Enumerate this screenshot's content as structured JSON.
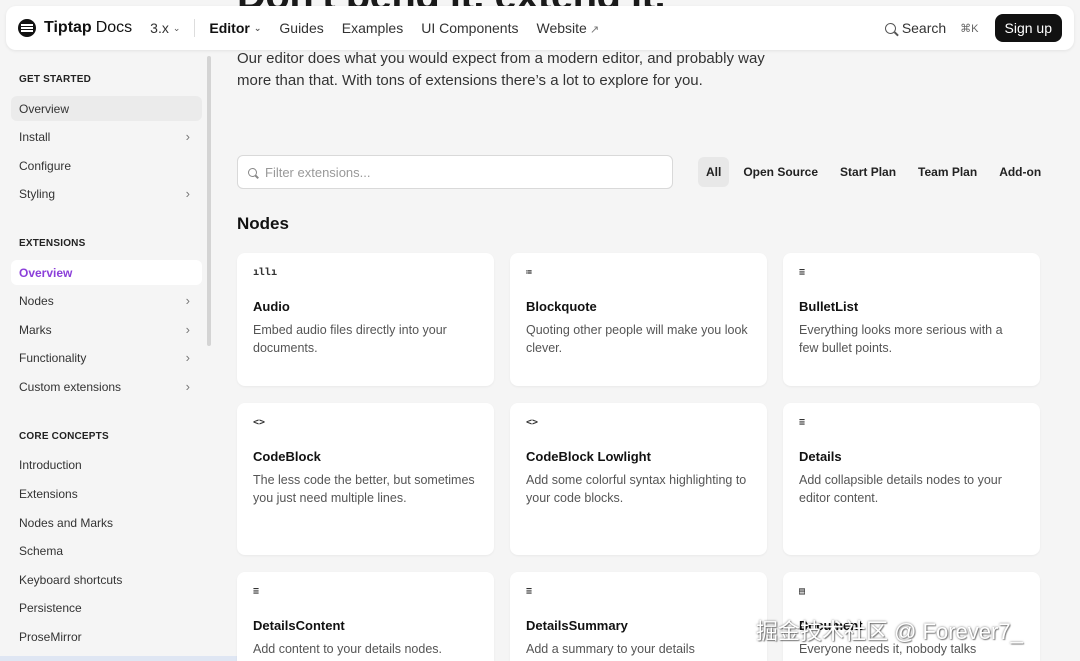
{
  "hero": {
    "title": "Don't bend it, extend it."
  },
  "header": {
    "logo_name": "Tiptap",
    "logo_sub": "Docs",
    "version": "3.x",
    "nav": [
      {
        "label": "Editor"
      },
      {
        "label": "Guides"
      },
      {
        "label": "Examples"
      },
      {
        "label": "UI Components"
      },
      {
        "label": "Website"
      }
    ],
    "search_label": "Search",
    "search_kbd": "⌘K",
    "signup_label": "Sign up"
  },
  "sidebar": {
    "groups": [
      {
        "title": "GET STARTED",
        "items": [
          "Overview",
          "Install",
          "Configure",
          "Styling"
        ]
      },
      {
        "title": "EXTENSIONS",
        "items": [
          "Overview",
          "Nodes",
          "Marks",
          "Functionality",
          "Custom extensions"
        ]
      },
      {
        "title": "CORE CONCEPTS",
        "items": [
          "Introduction",
          "Extensions",
          "Nodes and Marks",
          "Schema",
          "Keyboard shortcuts",
          "Persistence",
          "ProseMirror"
        ]
      }
    ],
    "active_item": "Overview",
    "accent_color": "#8b3fd9"
  },
  "main": {
    "intro": "Our editor does what you would expect from a modern editor, and probably way more than that. With tons of extensions there’s a lot to explore for you.",
    "filter_placeholder": "Filter extensions...",
    "tabs": [
      "All",
      "Open Source",
      "Start Plan",
      "Team Plan",
      "Add-on"
    ],
    "section_title": "Nodes",
    "cards": [
      {
        "icon": "audio-icon",
        "glyph": "ıllı",
        "title": "Audio",
        "desc": "Embed audio files directly into your documents."
      },
      {
        "icon": "blockquote-icon",
        "glyph": "≔",
        "title": "Blockquote",
        "desc": "Quoting other people will make you look clever."
      },
      {
        "icon": "bullet-list-icon",
        "glyph": "≡",
        "title": "BulletList",
        "desc": "Everything looks more serious with a few bullet points."
      },
      {
        "icon": "code-icon",
        "glyph": "<>",
        "title": "CodeBlock",
        "desc": "The less code the better, but sometimes you just need multiple lines."
      },
      {
        "icon": "code-icon",
        "glyph": "<>",
        "title": "CodeBlock Lowlight",
        "desc": "Add some colorful syntax highlighting to your code blocks."
      },
      {
        "icon": "list-icon",
        "glyph": "≡",
        "title": "Details",
        "desc": "Add collapsible details nodes to your editor content."
      },
      {
        "icon": "text-icon",
        "glyph": "≡",
        "title": "DetailsContent",
        "desc": "Add content to your details nodes."
      },
      {
        "icon": "text-icon",
        "glyph": "≡",
        "title": "DetailsSummary",
        "desc": "Add a summary to your details"
      },
      {
        "icon": "document-icon",
        "glyph": "▤",
        "title": "Document",
        "desc": "Everyone needs it, nobody talks"
      }
    ]
  },
  "watermark": "掘金技术社区 @ Forever7_"
}
